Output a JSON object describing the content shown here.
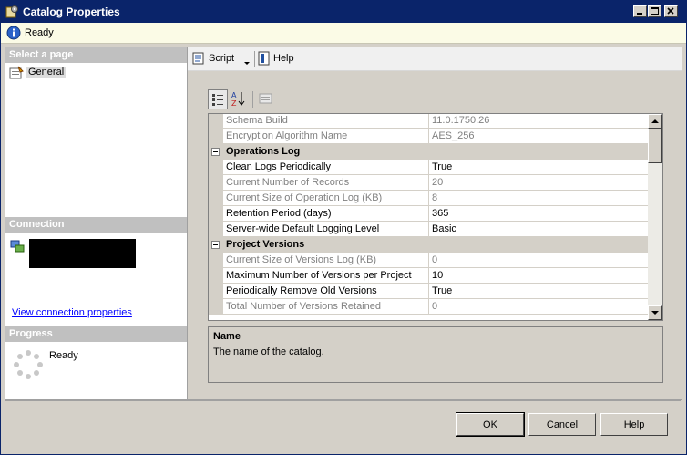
{
  "window": {
    "title": "Catalog Properties"
  },
  "status": {
    "text": "Ready"
  },
  "left": {
    "select_page_header": "Select a page",
    "pages": [
      {
        "label": "General"
      }
    ],
    "connection_header": "Connection",
    "view_connection_link": "View connection properties",
    "progress_header": "Progress",
    "progress_status": "Ready"
  },
  "toolbar": {
    "script_label": "Script",
    "help_label": "Help"
  },
  "grid": {
    "rows": [
      {
        "kind": "prop",
        "name": "Schema Build",
        "value": "11.0.1750.26",
        "readonly": true
      },
      {
        "kind": "prop",
        "name": "Encryption Algorithm Name",
        "value": "AES_256",
        "readonly": true
      },
      {
        "kind": "category",
        "name": "Operations Log"
      },
      {
        "kind": "prop",
        "name": "Clean Logs Periodically",
        "value": "True",
        "readonly": false
      },
      {
        "kind": "prop",
        "name": "Current Number of Records",
        "value": "20",
        "readonly": true
      },
      {
        "kind": "prop",
        "name": "Current Size of Operation Log (KB)",
        "value": "8",
        "readonly": true
      },
      {
        "kind": "prop",
        "name": "Retention Period (days)",
        "value": "365",
        "readonly": false
      },
      {
        "kind": "prop",
        "name": "Server-wide Default Logging Level",
        "value": "Basic",
        "readonly": false
      },
      {
        "kind": "category",
        "name": "Project Versions"
      },
      {
        "kind": "prop",
        "name": "Current Size of Versions Log (KB)",
        "value": "0",
        "readonly": true
      },
      {
        "kind": "prop",
        "name": "Maximum Number of Versions per Project",
        "value": "10",
        "readonly": false
      },
      {
        "kind": "prop",
        "name": "Periodically Remove Old Versions",
        "value": "True",
        "readonly": false
      },
      {
        "kind": "prop",
        "name": "Total Number of Versions Retained",
        "value": "0",
        "readonly": true
      }
    ]
  },
  "description": {
    "title": "Name",
    "text": "The name of the catalog."
  },
  "buttons": {
    "ok": "OK",
    "cancel": "Cancel",
    "help": "Help"
  },
  "colors": {
    "titlebar": "#0a246a",
    "status_bg": "#fbfbe6",
    "link": "#0000ff"
  }
}
